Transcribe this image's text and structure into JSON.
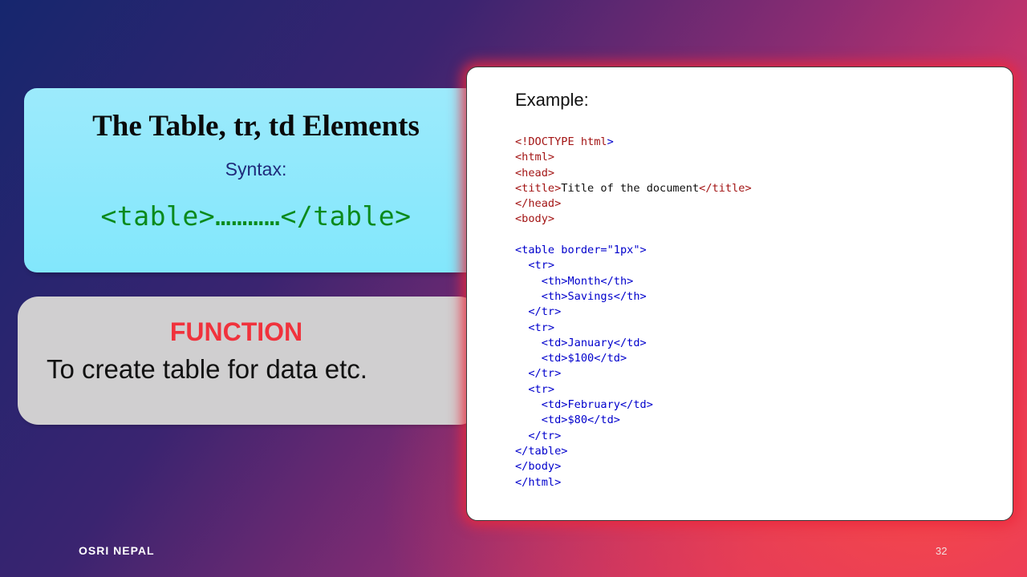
{
  "title_card": {
    "title": "The Table, tr, td Elements",
    "syntax_label": "Syntax:",
    "syntax_code": "<table>…………</table>"
  },
  "function_card": {
    "heading": "FUNCTION",
    "description": "To create table for data etc."
  },
  "example": {
    "label": "Example:",
    "lines": [
      {
        "indent": "",
        "parts": [
          {
            "text": "<!DOCTYPE ",
            "cls": "t-brown"
          },
          {
            "text": "html",
            "cls": "t-brown"
          },
          {
            "text": ">",
            "cls": "t-blue"
          }
        ]
      },
      {
        "indent": "",
        "parts": [
          {
            "text": "<html>",
            "cls": "t-brown"
          }
        ]
      },
      {
        "indent": "",
        "parts": [
          {
            "text": "<head>",
            "cls": "t-brown"
          }
        ]
      },
      {
        "indent": "",
        "parts": [
          {
            "text": "<title>",
            "cls": "t-brown"
          },
          {
            "text": "Title of the document",
            "cls": "t-text"
          },
          {
            "text": "</title>",
            "cls": "t-brown"
          }
        ]
      },
      {
        "indent": "",
        "parts": [
          {
            "text": "</head>",
            "cls": "t-brown"
          }
        ]
      },
      {
        "indent": "",
        "parts": [
          {
            "text": "<body>",
            "cls": "t-brown"
          }
        ]
      },
      {
        "indent": "",
        "parts": []
      },
      {
        "indent": "",
        "parts": [
          {
            "text": "<table border=\"1px\">",
            "cls": "t-blue"
          }
        ]
      },
      {
        "indent": "  ",
        "parts": [
          {
            "text": "<tr>",
            "cls": "t-blue"
          }
        ]
      },
      {
        "indent": "    ",
        "parts": [
          {
            "text": "<th>Month</th>",
            "cls": "t-blue"
          }
        ]
      },
      {
        "indent": "    ",
        "parts": [
          {
            "text": "<th>Savings</th>",
            "cls": "t-blue"
          }
        ]
      },
      {
        "indent": "  ",
        "parts": [
          {
            "text": "</tr>",
            "cls": "t-blue"
          }
        ]
      },
      {
        "indent": "  ",
        "parts": [
          {
            "text": "<tr>",
            "cls": "t-blue"
          }
        ]
      },
      {
        "indent": "    ",
        "parts": [
          {
            "text": "<td>January</td>",
            "cls": "t-blue"
          }
        ]
      },
      {
        "indent": "    ",
        "parts": [
          {
            "text": "<td>$100</td>",
            "cls": "t-blue"
          }
        ]
      },
      {
        "indent": "  ",
        "parts": [
          {
            "text": "</tr>",
            "cls": "t-blue"
          }
        ]
      },
      {
        "indent": "  ",
        "parts": [
          {
            "text": "<tr>",
            "cls": "t-blue"
          }
        ]
      },
      {
        "indent": "    ",
        "parts": [
          {
            "text": "<td>February</td>",
            "cls": "t-blue"
          }
        ]
      },
      {
        "indent": "    ",
        "parts": [
          {
            "text": "<td>$80</td>",
            "cls": "t-blue"
          }
        ]
      },
      {
        "indent": "  ",
        "parts": [
          {
            "text": "</tr>",
            "cls": "t-blue"
          }
        ]
      },
      {
        "indent": "",
        "parts": [
          {
            "text": "</table>",
            "cls": "t-blue"
          }
        ]
      },
      {
        "indent": "",
        "parts": [
          {
            "text": "</body>",
            "cls": "t-blue"
          }
        ]
      },
      {
        "indent": "",
        "parts": [
          {
            "text": "</html>",
            "cls": "t-blue"
          }
        ]
      }
    ]
  },
  "footer": {
    "brand": "OSRI NEPAL",
    "page_number": "32"
  },
  "colors": {
    "syntax_code": "#0b8a1c",
    "function_heading": "#f0323c",
    "code_tag_red": "#a31515",
    "code_tag_blue": "#0000cc"
  }
}
